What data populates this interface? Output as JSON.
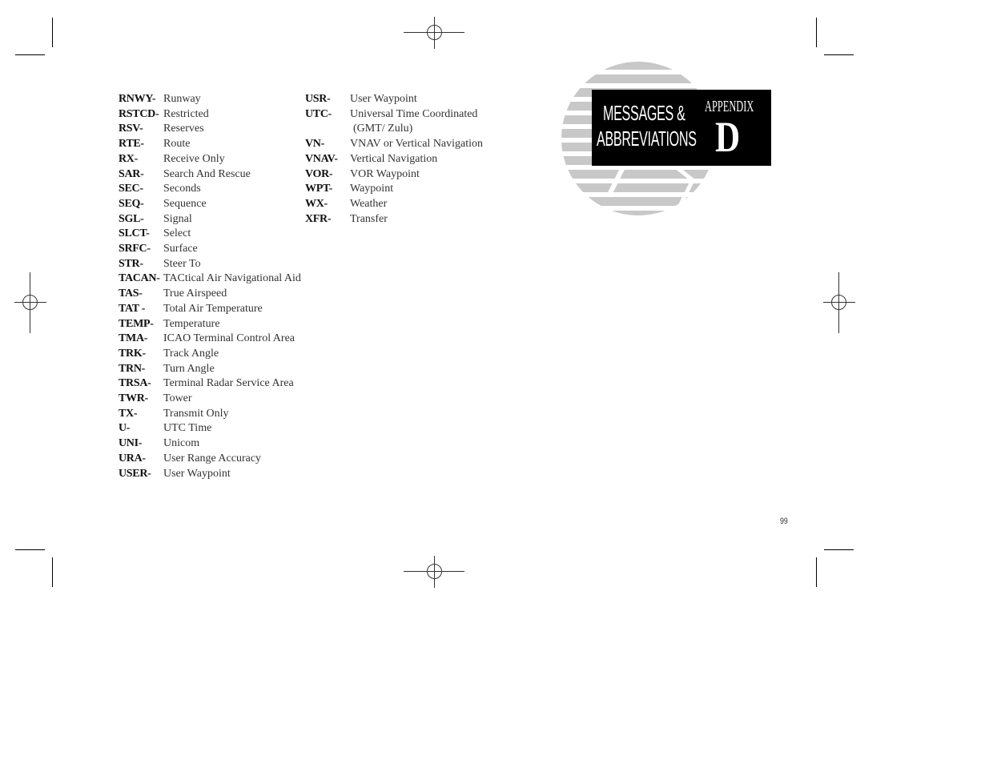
{
  "column1": [
    {
      "abbr": "RNWY-",
      "def": "Runway"
    },
    {
      "abbr": "RSTCD-",
      "def": "Restricted"
    },
    {
      "abbr": "RSV-",
      "def": "Reserves"
    },
    {
      "abbr": "RTE-",
      "def": "Route"
    },
    {
      "abbr": "RX-",
      "def": "Receive Only"
    },
    {
      "abbr": "SAR-",
      "def": "Search And Rescue"
    },
    {
      "abbr": "SEC-",
      "def": "Seconds"
    },
    {
      "abbr": "SEQ-",
      "def": "Sequence"
    },
    {
      "abbr": "SGL-",
      "def": "Signal"
    },
    {
      "abbr": "SLCT-",
      "def": "Select"
    },
    {
      "abbr": "SRFC-",
      "def": "Surface"
    },
    {
      "abbr": "STR-",
      "def": "Steer To"
    },
    {
      "abbr": "TACAN-",
      "def": "TACtical Air Navigational Aid"
    },
    {
      "abbr": "TAS-",
      "def": "True Airspeed"
    },
    {
      "abbr": "TAT -",
      "def": "Total Air Temperature"
    },
    {
      "abbr": "TEMP-",
      "def": "Temperature"
    },
    {
      "abbr": "TMA-",
      "def": "ICAO Terminal Control Area"
    },
    {
      "abbr": "TRK-",
      "def": "Track Angle"
    },
    {
      "abbr": "TRN-",
      "def": "Turn Angle"
    },
    {
      "abbr": "TRSA-",
      "def": "Terminal Radar Service Area"
    },
    {
      "abbr": "TWR-",
      "def": "Tower"
    },
    {
      "abbr": "TX-",
      "def": "Transmit Only"
    },
    {
      "abbr": "U-",
      "def": "UTC Time"
    },
    {
      "abbr": "UNI-",
      "def": "Unicom"
    },
    {
      "abbr": "URA-",
      "def": "User Range Accuracy"
    },
    {
      "abbr": "USER-",
      "def": "User Waypoint"
    }
  ],
  "column2": [
    {
      "abbr": "USR-",
      "def": "User Waypoint"
    },
    {
      "abbr": "UTC-",
      "def": "Universal Time Coordinated",
      "cont": "(GMT/ Zulu)"
    },
    {
      "abbr": "VN-",
      "def": "VNAV or Vertical Navigation"
    },
    {
      "abbr": "VNAV-",
      "def": "Vertical Navigation"
    },
    {
      "abbr": "VOR-",
      "def": "VOR Waypoint"
    },
    {
      "abbr": "WPT-",
      "def": "Waypoint"
    },
    {
      "abbr": "WX-",
      "def": "Weather"
    },
    {
      "abbr": "XFR-",
      "def": "Transfer"
    }
  ],
  "badge": {
    "line1": "MESSAGES &",
    "line2": "ABBREVIATIONS",
    "appendix": "APPENDIX",
    "letter": "D"
  },
  "page_number": "99",
  "colors": {
    "badge_bg": "#000000",
    "globe": "#c8c8c8"
  }
}
